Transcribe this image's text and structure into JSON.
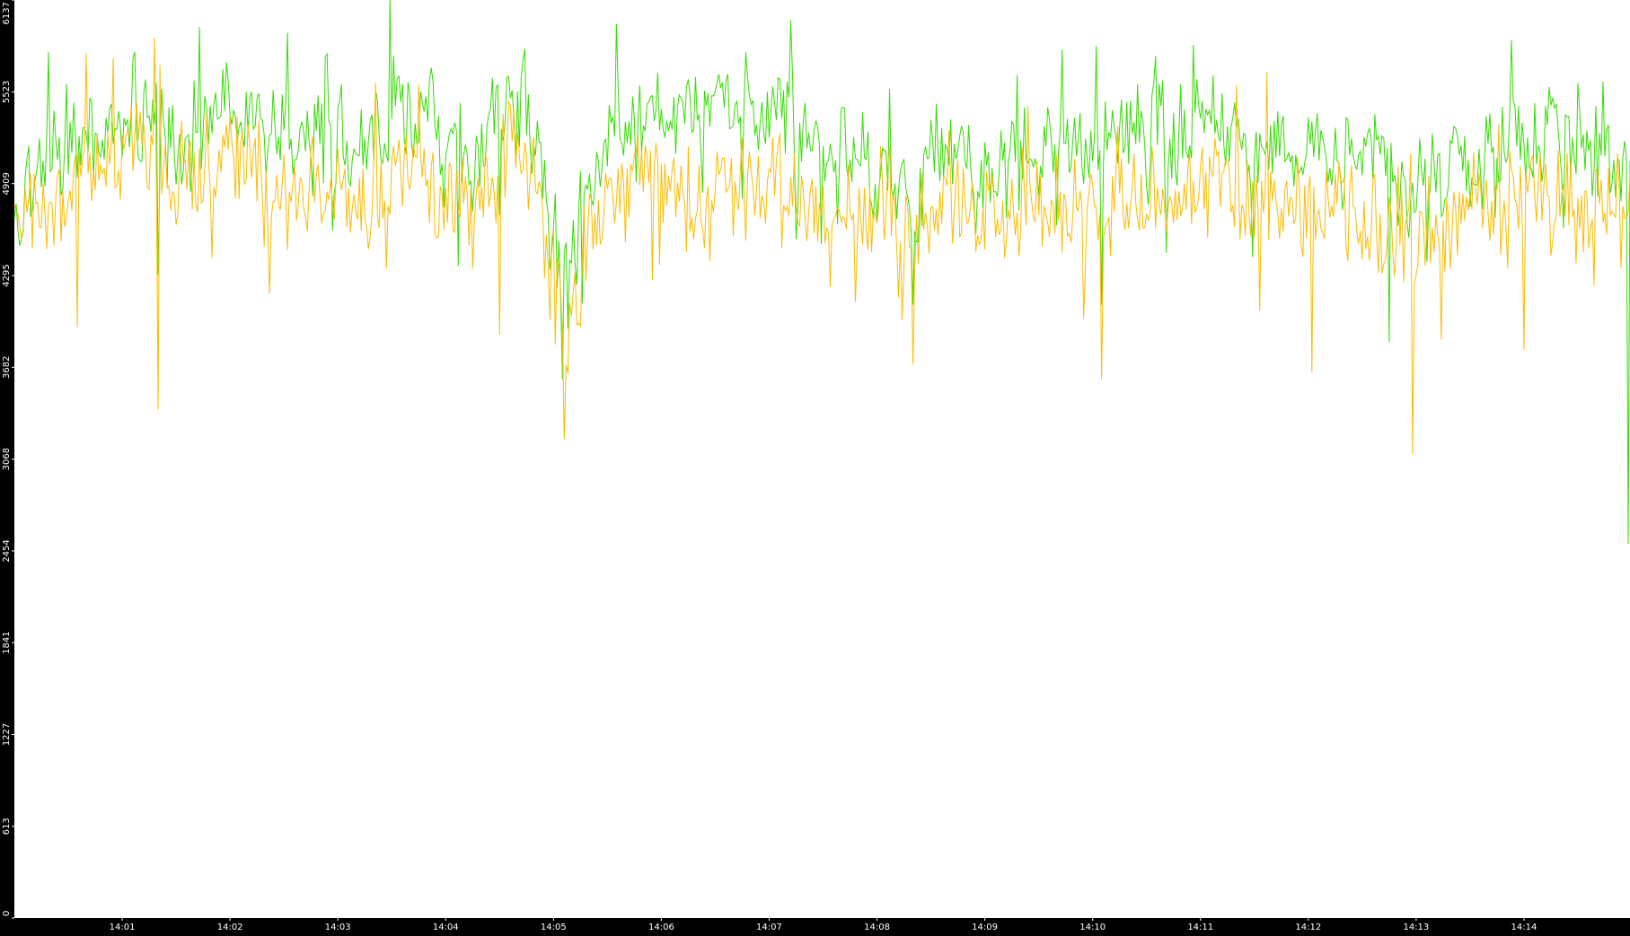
{
  "chart_data": {
    "type": "line",
    "title": "",
    "xlabel": "",
    "ylabel": "",
    "ylim": [
      0,
      6137
    ],
    "y_ticks": [
      0,
      613,
      1227,
      1841,
      2454,
      3068,
      3682,
      4295,
      4909,
      5523,
      6137
    ],
    "x_range": [
      "14:00:00",
      "14:14:59"
    ],
    "x_ticks": [
      "14:01",
      "14:02",
      "14:03",
      "14:04",
      "14:05",
      "14:06",
      "14:07",
      "14:08",
      "14:09",
      "14:10",
      "14:11",
      "14:12",
      "14:13",
      "14:14"
    ],
    "grid": false,
    "sample_interval_seconds": 1,
    "background_color": "#ffffff",
    "frame_color": "#000000",
    "series": [
      {
        "color": "#33dd00",
        "anchors": [
          [
            "14:00:00",
            4700
          ],
          [
            "14:00:15",
            5050
          ],
          [
            "14:00:30",
            5150
          ],
          [
            "14:00:45",
            5200
          ],
          [
            "14:01:00",
            5350
          ],
          [
            "14:01:15",
            5450
          ],
          [
            "14:01:30",
            5100
          ],
          [
            "14:01:45",
            5300
          ],
          [
            "14:02:00",
            5450
          ],
          [
            "14:02:15",
            5350
          ],
          [
            "14:02:30",
            5200
          ],
          [
            "14:02:45",
            5150
          ],
          [
            "14:03:00",
            5250
          ],
          [
            "14:03:15",
            5200
          ],
          [
            "14:03:30",
            5400
          ],
          [
            "14:03:45",
            5450
          ],
          [
            "14:04:00",
            5200
          ],
          [
            "14:04:15",
            5050
          ],
          [
            "14:04:30",
            5350
          ],
          [
            "14:04:45",
            5400
          ],
          [
            "14:05:00",
            4600
          ],
          [
            "14:05:08",
            4200
          ],
          [
            "14:05:20",
            4900
          ],
          [
            "14:05:35",
            5300
          ],
          [
            "14:05:50",
            5250
          ],
          [
            "14:06:05",
            5250
          ],
          [
            "14:06:20",
            5350
          ],
          [
            "14:06:35",
            5450
          ],
          [
            "14:06:50",
            5350
          ],
          [
            "14:07:05",
            5400
          ],
          [
            "14:07:20",
            5300
          ],
          [
            "14:07:35",
            5200
          ],
          [
            "14:07:50",
            5100
          ],
          [
            "14:08:05",
            5000
          ],
          [
            "14:08:20",
            4900
          ],
          [
            "14:08:35",
            5200
          ],
          [
            "14:08:50",
            5150
          ],
          [
            "14:09:05",
            5000
          ],
          [
            "14:09:20",
            5100
          ],
          [
            "14:09:35",
            5250
          ],
          [
            "14:09:50",
            5200
          ],
          [
            "14:10:05",
            5100
          ],
          [
            "14:10:20",
            5250
          ],
          [
            "14:10:35",
            5250
          ],
          [
            "14:10:50",
            5150
          ],
          [
            "14:11:00",
            5450
          ],
          [
            "14:11:15",
            5250
          ],
          [
            "14:11:30",
            5150
          ],
          [
            "14:11:45",
            5100
          ],
          [
            "14:12:00",
            5050
          ],
          [
            "14:12:15",
            5100
          ],
          [
            "14:12:30",
            5050
          ],
          [
            "14:12:45",
            5000
          ],
          [
            "14:13:00",
            4800
          ],
          [
            "14:13:15",
            5000
          ],
          [
            "14:13:30",
            5050
          ],
          [
            "14:13:45",
            5100
          ],
          [
            "14:14:00",
            5200
          ],
          [
            "14:14:15",
            5150
          ],
          [
            "14:14:30",
            5100
          ],
          [
            "14:14:45",
            5200
          ],
          [
            "14:14:57",
            5000
          ]
        ],
        "dips": [
          [
            "14:01:20",
            4300
          ],
          [
            "14:04:30",
            4700
          ],
          [
            "14:05:05",
            3600
          ],
          [
            "14:08:20",
            4100
          ],
          [
            "14:10:05",
            4100
          ],
          [
            "14:12:45",
            3850
          ],
          [
            "14:14:58",
            2500
          ]
        ]
      },
      {
        "color": "#ffbb00",
        "anchors": [
          [
            "14:00:00",
            4700
          ],
          [
            "14:00:15",
            4800
          ],
          [
            "14:00:30",
            4850
          ],
          [
            "14:00:45",
            5000
          ],
          [
            "14:01:00",
            5150
          ],
          [
            "14:01:15",
            5200
          ],
          [
            "14:01:30",
            4900
          ],
          [
            "14:01:45",
            5050
          ],
          [
            "14:02:00",
            5150
          ],
          [
            "14:02:15",
            4950
          ],
          [
            "14:02:30",
            4850
          ],
          [
            "14:02:45",
            4800
          ],
          [
            "14:03:00",
            4900
          ],
          [
            "14:03:15",
            4850
          ],
          [
            "14:03:30",
            5000
          ],
          [
            "14:03:45",
            5050
          ],
          [
            "14:04:00",
            4800
          ],
          [
            "14:04:15",
            4600
          ],
          [
            "14:04:30",
            5000
          ],
          [
            "14:04:45",
            5100
          ],
          [
            "14:05:00",
            4400
          ],
          [
            "14:05:08",
            3900
          ],
          [
            "14:05:20",
            4600
          ],
          [
            "14:05:35",
            5050
          ],
          [
            "14:05:50",
            4950
          ],
          [
            "14:06:05",
            4850
          ],
          [
            "14:06:20",
            4850
          ],
          [
            "14:06:35",
            4900
          ],
          [
            "14:06:50",
            4850
          ],
          [
            "14:07:05",
            4900
          ],
          [
            "14:07:20",
            4850
          ],
          [
            "14:07:35",
            4800
          ],
          [
            "14:07:50",
            4750
          ],
          [
            "14:08:05",
            4650
          ],
          [
            "14:08:20",
            4550
          ],
          [
            "14:08:35",
            4800
          ],
          [
            "14:08:50",
            4750
          ],
          [
            "14:09:05",
            4650
          ],
          [
            "14:09:20",
            4700
          ],
          [
            "14:09:35",
            4800
          ],
          [
            "14:09:50",
            4800
          ],
          [
            "14:10:05",
            4750
          ],
          [
            "14:10:20",
            4800
          ],
          [
            "14:10:35",
            4800
          ],
          [
            "14:10:50",
            4750
          ],
          [
            "14:11:00",
            5050
          ],
          [
            "14:11:15",
            4850
          ],
          [
            "14:11:30",
            4750
          ],
          [
            "14:11:45",
            4700
          ],
          [
            "14:12:00",
            4700
          ],
          [
            "14:12:15",
            4750
          ],
          [
            "14:12:30",
            4700
          ],
          [
            "14:12:45",
            4650
          ],
          [
            "14:13:00",
            4500
          ],
          [
            "14:13:15",
            4650
          ],
          [
            "14:13:30",
            4700
          ],
          [
            "14:13:45",
            4700
          ],
          [
            "14:14:00",
            4800
          ],
          [
            "14:14:15",
            4750
          ],
          [
            "14:14:30",
            4700
          ],
          [
            "14:14:45",
            4750
          ],
          [
            "14:14:57",
            4650
          ]
        ],
        "dips": [
          [
            "14:01:20",
            3400
          ],
          [
            "14:00:35",
            3950
          ],
          [
            "14:04:30",
            3900
          ],
          [
            "14:05:06",
            3200
          ],
          [
            "14:08:20",
            3700
          ],
          [
            "14:10:05",
            3600
          ],
          [
            "14:12:02",
            3650
          ],
          [
            "14:12:58",
            3100
          ],
          [
            "14:14:00",
            3800
          ]
        ]
      }
    ]
  }
}
